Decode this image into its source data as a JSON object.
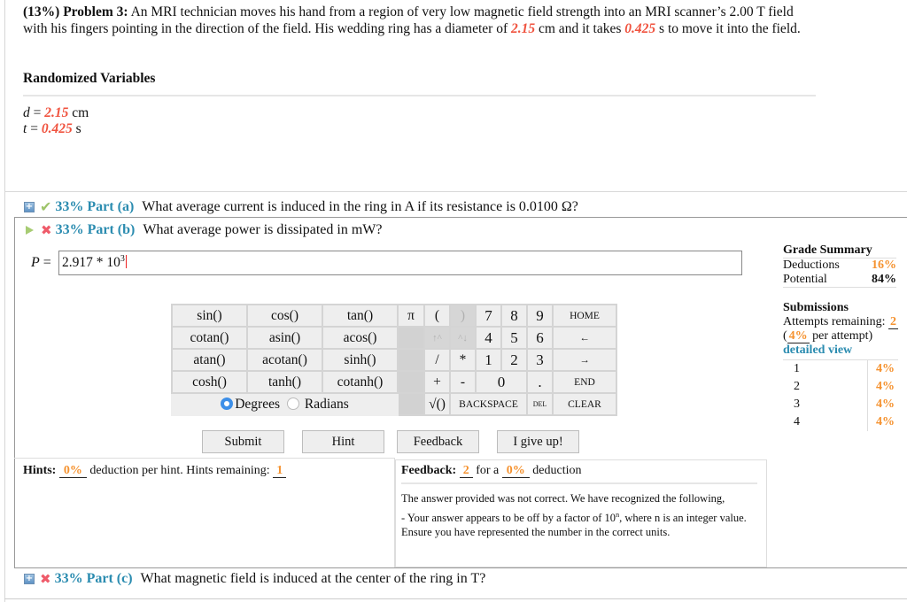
{
  "problem": {
    "weight": "(13%)",
    "label": "Problem 3:",
    "text_1": "An MRI technician moves his hand from a region of very low magnetic field strength into an MRI scanner’s 2.00 T field with his fingers pointing in the direction of the field. His wedding ring has a diameter of",
    "d_value": "2.15",
    "text_2": "cm and it takes",
    "t_value": "0.425",
    "text_3": "s to move it into the field."
  },
  "randomized_variables": {
    "title": "Randomized Variables",
    "items": [
      {
        "symbol": "d",
        "eq": "=",
        "value": "2.15",
        "unit": "cm"
      },
      {
        "symbol": "t",
        "eq": "=",
        "value": "0.425",
        "unit": "s"
      }
    ]
  },
  "parts": [
    {
      "percent": "33%",
      "label": "Part (a)",
      "question": "What average current is induced in the ring in A if its resistance is 0.0100 Ω?",
      "status": "correct"
    },
    {
      "percent": "33%",
      "label": "Part (b)",
      "question": "What average power is dissipated in mW?",
      "status": "incorrect"
    },
    {
      "percent": "33%",
      "label": "Part (c)",
      "question": "What magnetic field is induced at the center of the ring in T?",
      "status": "incorrect"
    }
  ],
  "answer": {
    "variable": "P",
    "eq": "=",
    "value_base": "2.917 * 10",
    "value_exp": "3"
  },
  "grade_summary": {
    "title": "Grade Summary",
    "deductions_label": "Deductions",
    "deductions_value": "16%",
    "potential_label": "Potential",
    "potential_value": "84%"
  },
  "submissions": {
    "title": "Submissions",
    "attempts_label": "Attempts remaining:",
    "attempts_value": "2",
    "per_attempt_open": "(",
    "per_attempt_value": "4%",
    "per_attempt_text": "per attempt)",
    "detailed_view": "detailed view",
    "rows": [
      {
        "n": "1",
        "v": "4%"
      },
      {
        "n": "2",
        "v": "4%"
      },
      {
        "n": "3",
        "v": "4%"
      },
      {
        "n": "4",
        "v": "4%"
      }
    ]
  },
  "keypad": {
    "functions": [
      [
        "sin()",
        "cos()",
        "tan()"
      ],
      [
        "cotan()",
        "asin()",
        "acos()"
      ],
      [
        "atan()",
        "acotan()",
        "sinh()"
      ],
      [
        "cosh()",
        "tanh()",
        "cotanh()"
      ]
    ],
    "degrees": "Degrees",
    "radians": "Radians",
    "pi": "π",
    "lparen": "(",
    "rparen": ")",
    "up": "↑^",
    "down": "^↓",
    "slash": "/",
    "star": "*",
    "plus": "+",
    "minus": "-",
    "sqrt": "√()",
    "digits": [
      "7",
      "8",
      "9",
      "4",
      "5",
      "6",
      "1",
      "2",
      "3",
      "0"
    ],
    "dot": ".",
    "home": "HOME",
    "left": "←",
    "right": "→",
    "end": "END",
    "backspace": "BACKSPACE",
    "del": "DEL",
    "clear": "CLEAR"
  },
  "buttons": {
    "submit": "Submit",
    "hint": "Hint",
    "feedback": "Feedback",
    "give_up": "I give up!"
  },
  "hints": {
    "label": "Hints:",
    "deduction": "0%",
    "text_1": "deduction per hint. Hints remaining:",
    "remaining": "1"
  },
  "feedback": {
    "label": "Feedback:",
    "count": "2",
    "text_1": "for a",
    "deduction": "0%",
    "text_2": "deduction",
    "message_1": "The answer provided was not correct. We have recognized the following,",
    "message_2a": "- Your answer appears to be off by a factor of 10",
    "message_2_exp": "n",
    "message_2b": ", where n is an integer value. Ensure you have represented the number in the correct units."
  }
}
